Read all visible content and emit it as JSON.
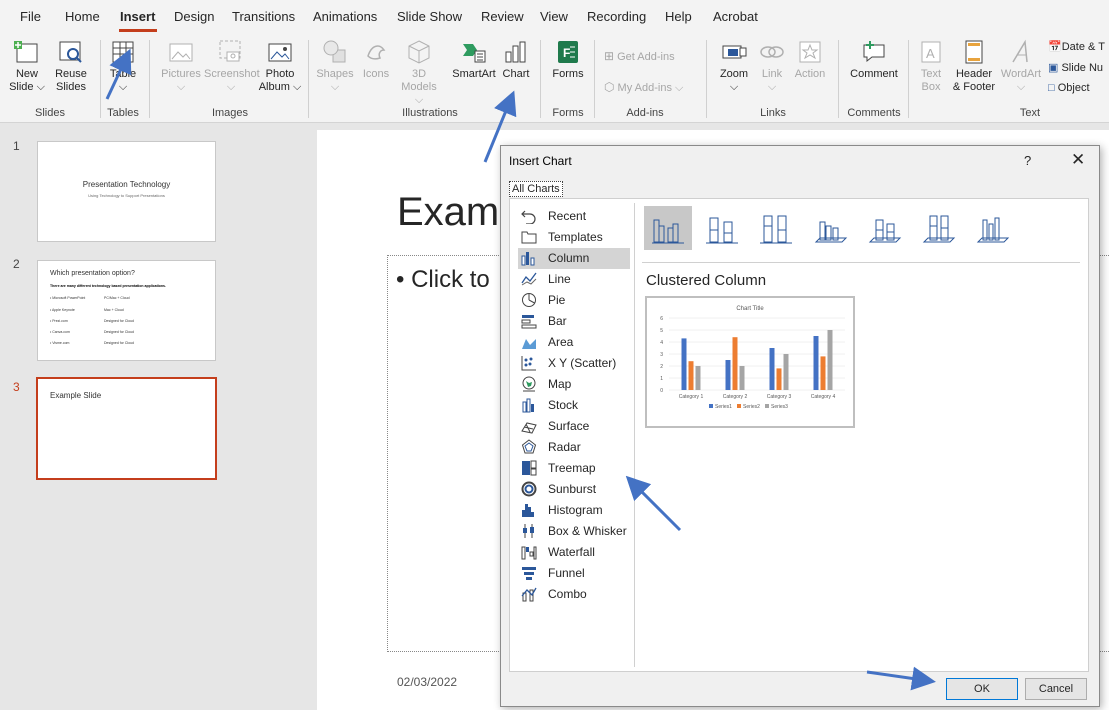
{
  "menu": {
    "tabs": [
      "File",
      "Home",
      "Insert",
      "Design",
      "Transitions",
      "Animations",
      "Slide Show",
      "Review",
      "View",
      "Recording",
      "Help",
      "Acrobat"
    ],
    "active": "Insert"
  },
  "ribbon": {
    "new_slide": [
      "New",
      "Slide ⌵"
    ],
    "reuse_slides": [
      "Reuse",
      "Slides"
    ],
    "table": [
      "Table",
      "⌵"
    ],
    "pictures": [
      "Pictures",
      "⌵"
    ],
    "screenshot": [
      "Screenshot",
      "⌵"
    ],
    "photo_album": [
      "Photo",
      "Album ⌵"
    ],
    "shapes": [
      "Shapes",
      "⌵"
    ],
    "icons": "Icons",
    "models_3d": [
      "3D",
      "Models ⌵"
    ],
    "smartart": "SmartArt",
    "chart": "Chart",
    "forms": "Forms",
    "get_addins": "Get Add-ins",
    "my_addins": "My Add-ins ⌵",
    "zoom": [
      "Zoom",
      "⌵"
    ],
    "link": [
      "Link",
      "⌵"
    ],
    "action": "Action",
    "comment": "Comment",
    "text_box": [
      "Text",
      "Box"
    ],
    "header_footer": [
      "Header",
      "& Footer"
    ],
    "wordart": [
      "WordArt",
      "⌵"
    ],
    "date_time": "Date & T",
    "slide_number": "Slide Nu",
    "object": "Object",
    "groups": {
      "slides": "Slides",
      "tables": "Tables",
      "images": "Images",
      "illustrations": "Illustrations",
      "forms": "Forms",
      "addins": "Add-ins",
      "links": "Links",
      "comments": "Comments",
      "text": "Text"
    }
  },
  "thumbnails": [
    {
      "num": "1",
      "title": "Presentation Technology",
      "subtitle": "Using Technology to Support Presentations"
    },
    {
      "num": "2",
      "title": "Which presentation option?",
      "intro": "There are many different technology based presentation applications.",
      "rows": [
        [
          "• Microsoft PowerPoint",
          "PC/Mac + Cloud"
        ],
        [
          "• Apple Keynote",
          "Mac + Cloud"
        ],
        [
          "• Prezi.com",
          "Designed for Cloud"
        ],
        [
          "• Canva.com",
          "Designed for Cloud"
        ],
        [
          "• Visme.com",
          "Designed for Cloud"
        ]
      ]
    },
    {
      "num": "3",
      "title": "Example Slide"
    }
  ],
  "slide": {
    "title": "Examp",
    "body": "• Click to",
    "date": "02/03/2022"
  },
  "dialog": {
    "title": "Insert Chart",
    "help": "?",
    "close": "✕",
    "tab": "All Charts",
    "chart_types": [
      "Recent",
      "Templates",
      "Column",
      "Line",
      "Pie",
      "Bar",
      "Area",
      "X Y (Scatter)",
      "Map",
      "Stock",
      "Surface",
      "Radar",
      "Treemap",
      "Sunburst",
      "Histogram",
      "Box & Whisker",
      "Waterfall",
      "Funnel",
      "Combo"
    ],
    "selected_type": "Column",
    "subtype_name": "Clustered Column",
    "ok": "OK",
    "cancel": "Cancel"
  },
  "chart_data": {
    "type": "bar",
    "title": "Chart Title",
    "categories": [
      "Category 1",
      "Category 2",
      "Category 3",
      "Category 4"
    ],
    "series": [
      {
        "name": "Series1",
        "values": [
          4.3,
          2.5,
          3.5,
          4.5
        ]
      },
      {
        "name": "Series2",
        "values": [
          2.4,
          4.4,
          1.8,
          2.8
        ]
      },
      {
        "name": "Series3",
        "values": [
          2,
          2,
          3,
          5
        ]
      }
    ],
    "ylim": [
      0,
      6
    ],
    "yticks": [
      "0",
      "1",
      "2",
      "3",
      "4",
      "5",
      "6"
    ],
    "legend": "bottom",
    "colors": [
      "#4472c4",
      "#ed7d31",
      "#a5a5a5"
    ]
  },
  "accent": "#c43e1c",
  "annotation_color": "#4472c4"
}
